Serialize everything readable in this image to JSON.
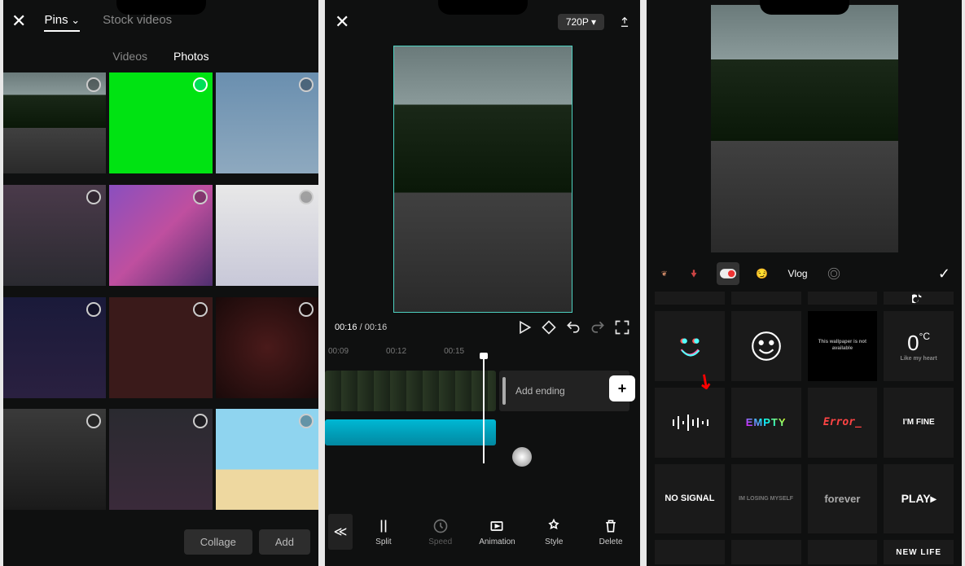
{
  "phone1": {
    "top_tabs": {
      "pins": "Pins",
      "stock": "Stock videos"
    },
    "sub_tabs": {
      "videos": "Videos",
      "photos": "Photos"
    },
    "buttons": {
      "collage": "Collage",
      "add": "Add"
    }
  },
  "phone2": {
    "resolution": "720P ▾",
    "time": {
      "current": "00:16",
      "total": "00:16"
    },
    "ruler": {
      "t1": "00:09",
      "t2": "00:12",
      "t3": "00:15"
    },
    "add_ending": "Add ending",
    "tools": {
      "split": "Split",
      "speed": "Speed",
      "animation": "Animation",
      "style": "Style",
      "delete": "Delete"
    }
  },
  "phone3": {
    "tag_vlog": "Vlog",
    "stickers": {
      "temp": "0",
      "temp_unit": "°C",
      "temp_sub": "Like my heart",
      "wall_sub": "This wallpaper is not available",
      "empty": "EMPTY",
      "error": "Error_",
      "fine": "I'M FINE",
      "nosignal": "NO SIGNAL",
      "losing": "IM LOSING MYSELF",
      "forever": "forever",
      "play": "PLAY",
      "newlife": "NEW LIFE"
    }
  }
}
